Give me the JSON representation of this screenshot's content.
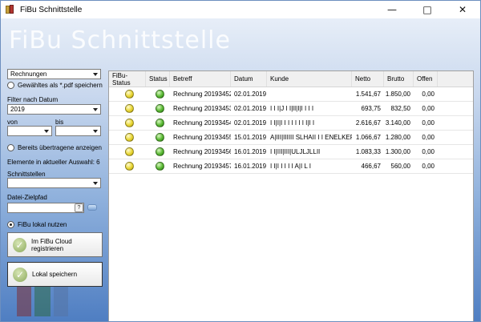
{
  "window": {
    "title": "FiBu Schnittstelle"
  },
  "banner": {
    "title": "FiBu Schnittstelle"
  },
  "sidebar": {
    "document_type": {
      "value": "Rechnungen"
    },
    "save_pdf_label": "Gewähltes als *.pdf speichern",
    "filter_label": "Filter nach Datum",
    "year": {
      "value": "2019"
    },
    "from_label": "von",
    "to_label": "bis",
    "from_value": "",
    "to_value": "",
    "show_transferred_label": "Bereits übertragene anzeigen",
    "element_count_label": "Elemente in aktueller Auswahl: 6",
    "interfaces_label": "Schnittstellen",
    "interfaces_value": "",
    "path_label": "Datei-Zielpfad",
    "path_value": "",
    "help_glyph": "?",
    "local_radio_label": "FiBu lokal nutzen",
    "cloud_button_label": "Im FiBu Cloud registrieren",
    "save_button_label": "Lokal speichern"
  },
  "table": {
    "columns": [
      "FiBu-Status",
      "Status",
      "Betreff",
      "Datum",
      "Kunde",
      "Netto",
      "Brutto",
      "Offen"
    ],
    "rows": [
      {
        "fibu_status": "yellow",
        "status": "green",
        "betreff": "Rechnung 20193452",
        "datum": "02.01.2019",
        "kunde": "",
        "netto": "1.541,67",
        "brutto": "1.850,00",
        "offen": "0,00"
      },
      {
        "fibu_status": "yellow",
        "status": "green",
        "betreff": "Rechnung 20193453",
        "datum": "02.01.2019",
        "kunde": "I I I|J I I|lI|I|I I I I",
        "netto": "693,75",
        "brutto": "832,50",
        "offen": "0,00"
      },
      {
        "fibu_status": "yellow",
        "status": "green",
        "betreff": "Rechnung 20193454",
        "datum": "02.01.2019",
        "kunde": "I I|I|I I I I I I I I|I I",
        "netto": "2.616,67",
        "brutto": "3.140,00",
        "offen": "0,00"
      },
      {
        "fibu_status": "yellow",
        "status": "green",
        "betreff": "Rechnung 20193455",
        "datum": "15.01.2019",
        "kunde": "A|III|IIIIII SLHAII I I ENELKER",
        "netto": "1.066,67",
        "brutto": "1.280,00",
        "offen": "0,00"
      },
      {
        "fibu_status": "yellow",
        "status": "green",
        "betreff": "Rechnung 20193456",
        "datum": "16.01.2019",
        "kunde": "I I|III|III|ULJLJLLII",
        "netto": "1.083,33",
        "brutto": "1.300,00",
        "offen": "0,00"
      },
      {
        "fibu_status": "yellow",
        "status": "green",
        "betreff": "Rechnung 20193457",
        "datum": "16.01.2019",
        "kunde": "I I|I I I I I A|I L I",
        "netto": "466,67",
        "brutto": "560,00",
        "offen": "0,00"
      }
    ]
  },
  "colors": {
    "yellow": "#e8d632",
    "green": "#58b832",
    "accent": "#4f7ec2"
  }
}
